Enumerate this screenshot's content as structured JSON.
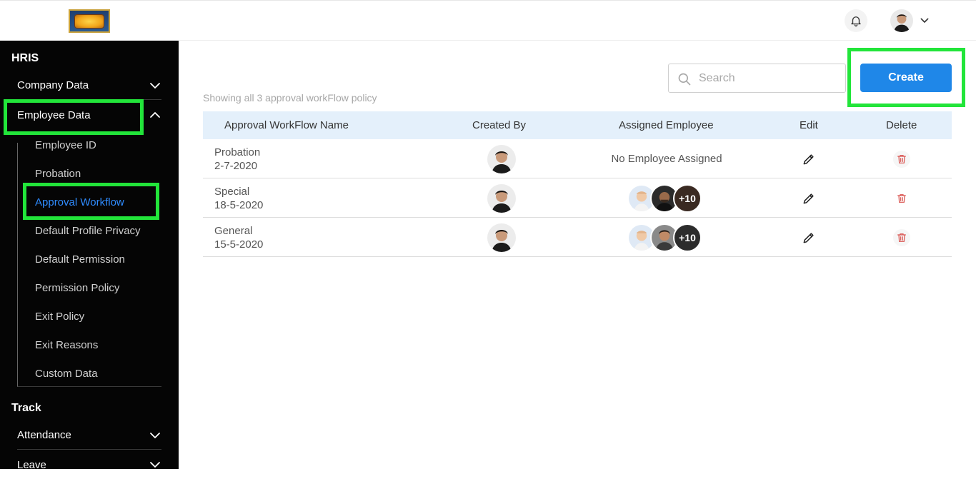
{
  "header": {
    "logo_icon": "bollywood-logo-icon",
    "notification_icon": "bell-icon",
    "profile_icon": "avatar",
    "profile_menu_icon": "chevron-down-icon"
  },
  "sidebar": {
    "sections": [
      {
        "title": "HRIS"
      },
      {
        "title": "Track"
      }
    ],
    "hris_items": [
      {
        "label": "Company Data",
        "expanded": false
      },
      {
        "label": "Employee Data",
        "expanded": true
      }
    ],
    "employee_data_sub": [
      {
        "label": "Employee ID"
      },
      {
        "label": "Probation"
      },
      {
        "label": "Approval Workflow",
        "active": true
      },
      {
        "label": "Default Profile Privacy"
      },
      {
        "label": "Default Permission"
      },
      {
        "label": "Permission Policy"
      },
      {
        "label": "Exit Policy"
      },
      {
        "label": "Exit Reasons"
      },
      {
        "label": "Custom Data"
      }
    ],
    "track_items": [
      {
        "label": "Attendance"
      },
      {
        "label": "Leave"
      }
    ]
  },
  "main": {
    "count_text": "Showing all 3 approval workFlow policy",
    "search": {
      "placeholder": "Search",
      "value": ""
    },
    "create_label": "Create",
    "table": {
      "headers": [
        "Approval WorkFlow Name",
        "Created By",
        "Assigned Employee",
        "Edit",
        "Delete"
      ],
      "rows": [
        {
          "name": "Probation",
          "date": "2-7-2020",
          "assigned_text": "No Employee Assigned",
          "more": ""
        },
        {
          "name": "Special",
          "date": "18-5-2020",
          "assigned_text": "",
          "more": "+10"
        },
        {
          "name": "General",
          "date": "15-5-2020",
          "assigned_text": "",
          "more": "+10"
        }
      ]
    }
  },
  "colors": {
    "sidebar_bg": "#050505",
    "accent_blue": "#1f87e8",
    "active_link": "#2f8cff",
    "highlight_green": "#22e53a",
    "table_header_bg": "#e4f0fb",
    "delete_red": "#d9534f"
  }
}
